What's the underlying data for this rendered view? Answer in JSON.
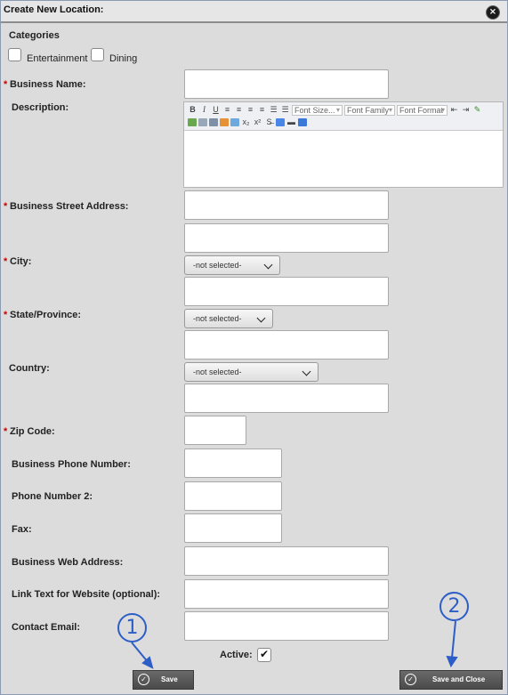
{
  "dialog": {
    "title": "Create New Location:",
    "close_glyph": "⨯"
  },
  "categories": {
    "heading": "Categories",
    "options": [
      {
        "label": "Entertainment",
        "checked": false
      },
      {
        "label": "Dining",
        "checked": false
      }
    ]
  },
  "fields": {
    "business_name": {
      "label": "Business Name:",
      "required": true,
      "value": ""
    },
    "description": {
      "label": "Description:",
      "required": false,
      "value": ""
    },
    "street_address": {
      "label": "Business Street Address:",
      "required": true,
      "value": "",
      "value2": ""
    },
    "city": {
      "label": "City:",
      "required": true,
      "select": "-not selected-",
      "value": ""
    },
    "state": {
      "label": "State/Province:",
      "required": true,
      "select": "-not selected-",
      "value": ""
    },
    "country": {
      "label": "Country:",
      "required": false,
      "select": "-not selected-",
      "value": ""
    },
    "zip": {
      "label": "Zip Code:",
      "required": true,
      "value": ""
    },
    "phone": {
      "label": "Business Phone Number:",
      "required": false,
      "value": ""
    },
    "phone2": {
      "label": "Phone Number 2:",
      "required": false,
      "value": ""
    },
    "fax": {
      "label": "Fax:",
      "required": false,
      "value": ""
    },
    "web": {
      "label": "Business Web Address:",
      "required": false,
      "value": ""
    },
    "link_text": {
      "label": "Link Text for Website (optional):",
      "required": false,
      "value": ""
    },
    "email": {
      "label": "Contact Email:",
      "required": false,
      "value": ""
    }
  },
  "required_marker": "*",
  "editor_toolbar": {
    "bold": "B",
    "italic": "I",
    "underline": "U",
    "font_size": "Font Size...",
    "font_family": "Font Family",
    "font_format": "Font Format",
    "subscript": "x₂",
    "superscript": "x²"
  },
  "active": {
    "label": "Active:",
    "checked": true,
    "glyph": "✔"
  },
  "buttons": {
    "save": "Save",
    "save_close": "Save and Close",
    "check_glyph": "✓"
  },
  "annotations": {
    "callout_1": "1",
    "callout_2": "2",
    "color": "#2d5ec7"
  }
}
